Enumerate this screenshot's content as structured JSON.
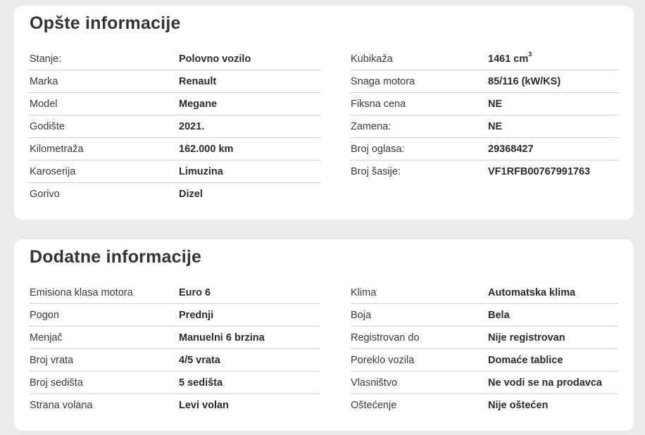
{
  "general": {
    "title": "Opšte informacije",
    "left": [
      {
        "label": "Stanje:",
        "value": "Polovno vozilo"
      },
      {
        "label": "Marka",
        "value": "Renault"
      },
      {
        "label": "Model",
        "value": "Megane"
      },
      {
        "label": "Godište",
        "value": "2021."
      },
      {
        "label": "Kilometraža",
        "value": "162.000 km"
      },
      {
        "label": "Karoserija",
        "value": "Limuzina"
      },
      {
        "label": "Gorivo",
        "value": "Dizel"
      }
    ],
    "right": [
      {
        "label": "Kubikaža",
        "value": "1461 cm",
        "sup": "3"
      },
      {
        "label": "Snaga motora",
        "value": "85/116 (kW/KS)"
      },
      {
        "label": "Fiksna cena",
        "value": "NE"
      },
      {
        "label": "Zamena:",
        "value": "NE"
      },
      {
        "label": "Broj oglasa:",
        "value": "29368427"
      },
      {
        "label": "Broj šasije:",
        "value": "VF1RFB00767991763"
      }
    ]
  },
  "additional": {
    "title": "Dodatne informacije",
    "left": [
      {
        "label": "Emisiona klasa motora",
        "value": "Euro 6"
      },
      {
        "label": "Pogon",
        "value": "Prednji"
      },
      {
        "label": "Menjač",
        "value": "Manuelni 6 brzina"
      },
      {
        "label": "Broj vrata",
        "value": "4/5 vrata"
      },
      {
        "label": "Broj sedišta",
        "value": "5 sedišta"
      },
      {
        "label": "Strana volana",
        "value": "Levi volan"
      }
    ],
    "right": [
      {
        "label": "Klima",
        "value": "Automatska klima"
      },
      {
        "label": "Boja",
        "value": "Bela"
      },
      {
        "label": "Registrovan do",
        "value": "Nije registrovan"
      },
      {
        "label": "Poreklo vozila",
        "value": "Domaće tablice"
      },
      {
        "label": "Vlasništvo",
        "value": "Ne vodi se na prodavca"
      },
      {
        "label": "Oštećenje",
        "value": "Nije oštećen"
      }
    ]
  }
}
